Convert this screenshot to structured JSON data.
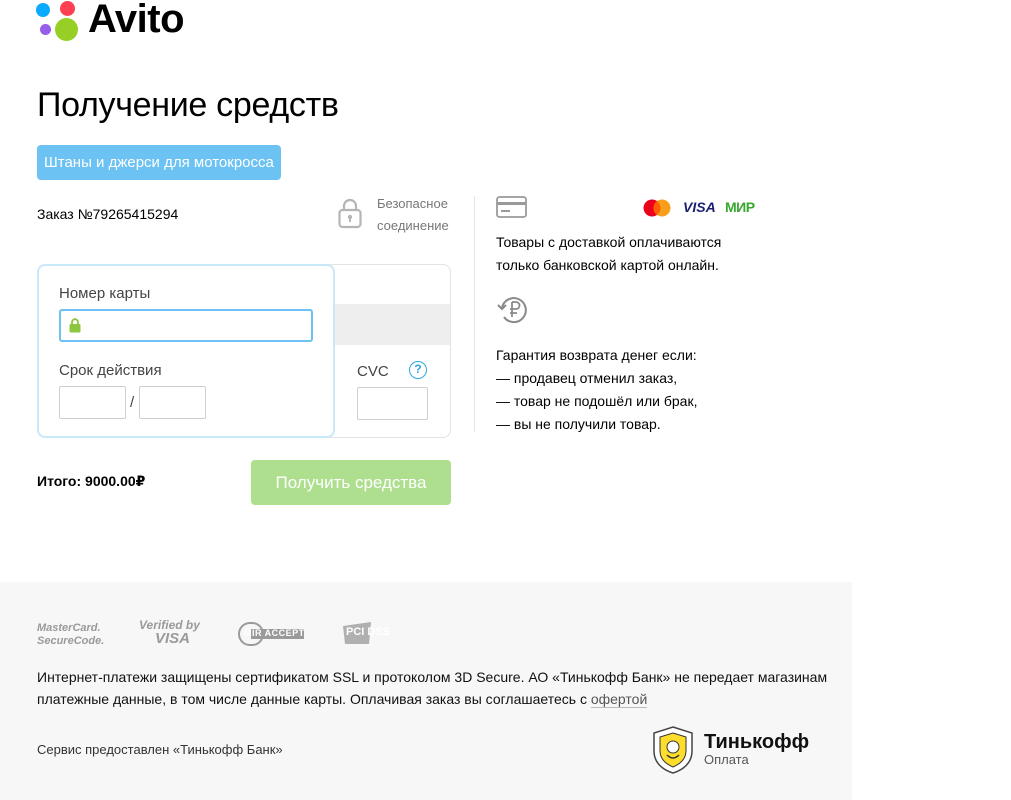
{
  "brand": {
    "name": "Avito",
    "dot_colors": [
      "#0aaaff",
      "#ff4053",
      "#965eeb",
      "#97cf26"
    ]
  },
  "page": {
    "title": "Получение средств",
    "product_tag": "Штаны и джерси для мотокросса",
    "order_number": "Заказ №79265415294",
    "secure_line1": "Безопасное",
    "secure_line2": "соединение"
  },
  "card_form": {
    "card_number_label": "Номер карты",
    "card_number_value": "",
    "expiry_label": "Срок действия",
    "expiry_separator": "/",
    "expiry_month_value": "",
    "expiry_year_value": "",
    "cvc_label": "CVC",
    "cvc_help": "?",
    "cvc_value": ""
  },
  "summary": {
    "total": "Итого: 9000.00₽",
    "submit_label": "Получить средства"
  },
  "info": {
    "payment_brands": [
      "mastercard-icon",
      "VISA",
      "МИР"
    ],
    "delivery_line1": "Товары с доставкой оплачиваются",
    "delivery_line2": "только банковской картой онлайн.",
    "guarantee_title": "Гарантия возврата денег если:",
    "guarantee_items": [
      "— продавец отменил заказ,",
      "— товар не подошёл или брак,",
      "— вы не получили товар."
    ]
  },
  "footer": {
    "mc_line1": "MasterCard.",
    "mc_line2": "SecureCode.",
    "vbv_line1": "Verified by",
    "vbv_line2": "VISA",
    "mir_accept": "MIR ACCEPT",
    "pci": "PCI DSS",
    "security_text": "Интернет-платежи защищены сертификатом SSL и протоколом 3D Secure. АО «Тинькофф Банк» не передает магазинам платежные данные, в том числе данные карты. Оплачивая заказ вы соглашаетесь с ",
    "offer_link": "офертой",
    "service_text": "Сервис предоставлен «Тинькофф Банк»",
    "tinkoff_name": "Тинькофф",
    "tinkoff_sub": "Оплата"
  },
  "colors": {
    "accent_blue": "#6cc2f2",
    "button_green": "#addf8f",
    "mir_green": "#37a72e",
    "visa_blue": "#1a1f71"
  }
}
